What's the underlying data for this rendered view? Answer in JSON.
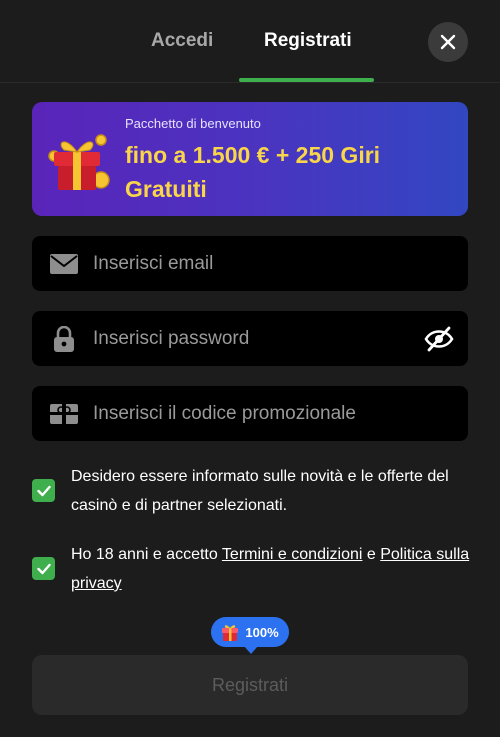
{
  "tabs": {
    "login": "Accedi",
    "register": "Registrati"
  },
  "banner": {
    "subtitle": "Pacchetto di benvenuto",
    "title": "fino a 1.500 € + 250 Giri Gratuiti"
  },
  "form": {
    "email_placeholder": "Inserisci email",
    "password_placeholder": "Inserisci password",
    "promo_placeholder": "Inserisci il codice promozionale"
  },
  "consents": {
    "newsletter": "Desidero essere informato sulle novità e le offerte del casinò e di partner selezionati.",
    "age_prefix": "Ho 18 anni e accetto ",
    "terms_link": "Termini e condizioni",
    "age_mid": " e ",
    "privacy_link": "Politica sulla privacy"
  },
  "bonus_badge": "100%",
  "submit_label": "Registrati",
  "colors": {
    "accent_green": "#3fae4c",
    "banner_highlight": "#f9d54a",
    "badge_blue": "#2c72f0"
  }
}
